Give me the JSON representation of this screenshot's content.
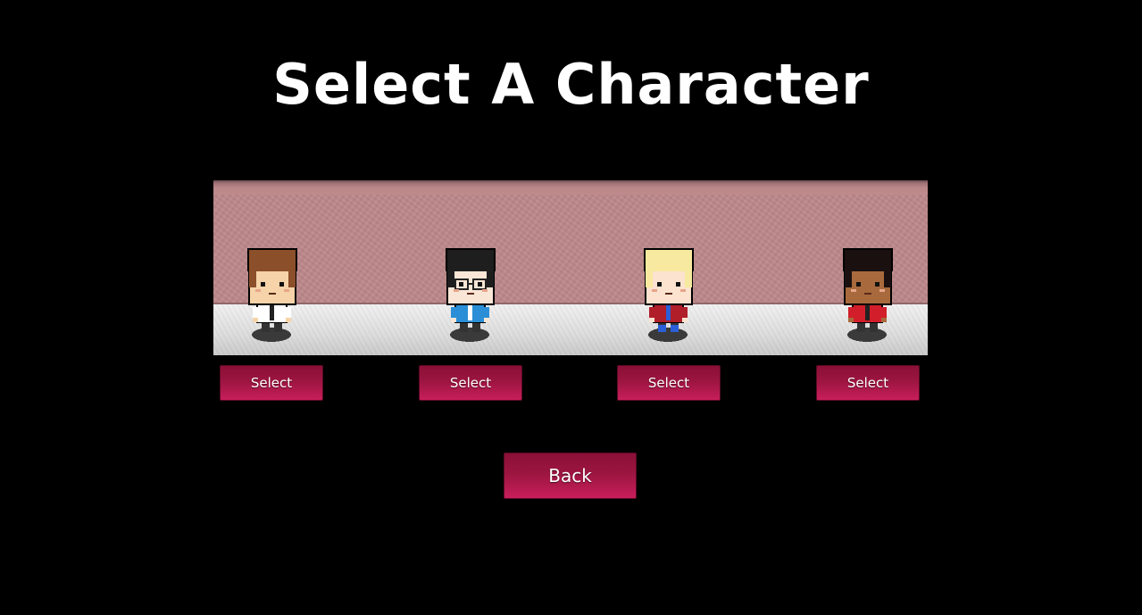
{
  "screen": {
    "title": "Select A Character"
  },
  "characters": [
    {
      "select_label": "Select",
      "hair_color": "#8b4f2a",
      "skin_color": "#f6d3a8",
      "top_color": "#ffffff",
      "accent_color": "#222222",
      "glasses": false
    },
    {
      "select_label": "Select",
      "hair_color": "#1e1e1e",
      "skin_color": "#fae6d6",
      "top_color": "#2a8fd6",
      "accent_color": "#ffffff",
      "glasses": true
    },
    {
      "select_label": "Select",
      "hair_color": "#f7eaa0",
      "skin_color": "#fbe3cf",
      "top_color": "#b01e2a",
      "accent_color": "#2a5fd8",
      "glasses": false
    },
    {
      "select_label": "Select",
      "hair_color": "#1a1010",
      "skin_color": "#a86a3c",
      "top_color": "#d21e2a",
      "accent_color": "#222222",
      "glasses": false
    }
  ],
  "back_label": "Back",
  "colors": {
    "background": "#000000",
    "button": "#a3174a",
    "wall": "#bf8a8c",
    "floor": "#e2e2e2"
  }
}
